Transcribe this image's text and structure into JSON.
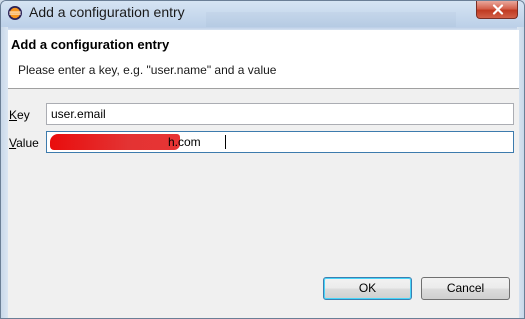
{
  "window": {
    "title": "Add a configuration entry",
    "title_icon": "eclipse-icon",
    "close_icon": "close-icon"
  },
  "header": {
    "title": "Add a configuration entry",
    "message": "Please enter a key, e.g. \"user.name\" and a value"
  },
  "form": {
    "key": {
      "label_mnemonic": "K",
      "label_rest": "ey",
      "value": "user.email"
    },
    "value": {
      "label_mnemonic": "V",
      "label_rest": "alue",
      "value_visible_suffix": "h.com"
    }
  },
  "buttons": {
    "ok": "OK",
    "cancel": "Cancel"
  },
  "colors": {
    "redaction": "#e00000",
    "default_button_border": "#3c7fb1"
  }
}
